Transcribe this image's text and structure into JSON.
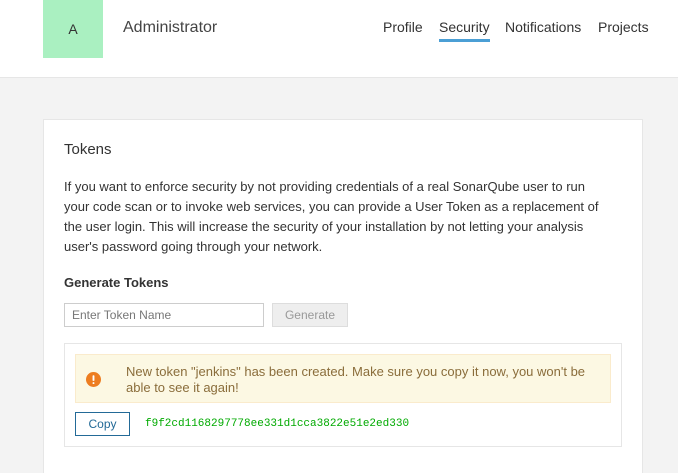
{
  "header": {
    "avatar_letter": "A",
    "user_name": "Administrator",
    "avatar_color": "#aaf0c1"
  },
  "nav": {
    "items": [
      {
        "label": "Profile",
        "active": false
      },
      {
        "label": "Security",
        "active": true
      },
      {
        "label": "Notifications",
        "active": false
      },
      {
        "label": "Projects",
        "active": false
      }
    ],
    "active_color": "#4b9fd5"
  },
  "tokens": {
    "title": "Tokens",
    "description": "If you want to enforce security by not providing credentials of a real SonarQube user to run your code scan or to invoke web services, you can provide a User Token as a replacement of the user login. This will increase the security of your installation by not letting your analysis user's password going through your network.",
    "generate_title": "Generate Tokens",
    "input_placeholder": "Enter Token Name",
    "input_value": "",
    "generate_label": "Generate",
    "alert_icon": "warning-circle-icon",
    "alert_message": "New token \"jenkins\" has been created. Make sure you copy it now, you won't be able to see it again!",
    "copy_label": "Copy",
    "token_value": "f9f2cd1168297778ee331d1cca3822e51e2ed330",
    "token_color": "#00aa00",
    "alert_icon_color": "#ed7d20"
  }
}
